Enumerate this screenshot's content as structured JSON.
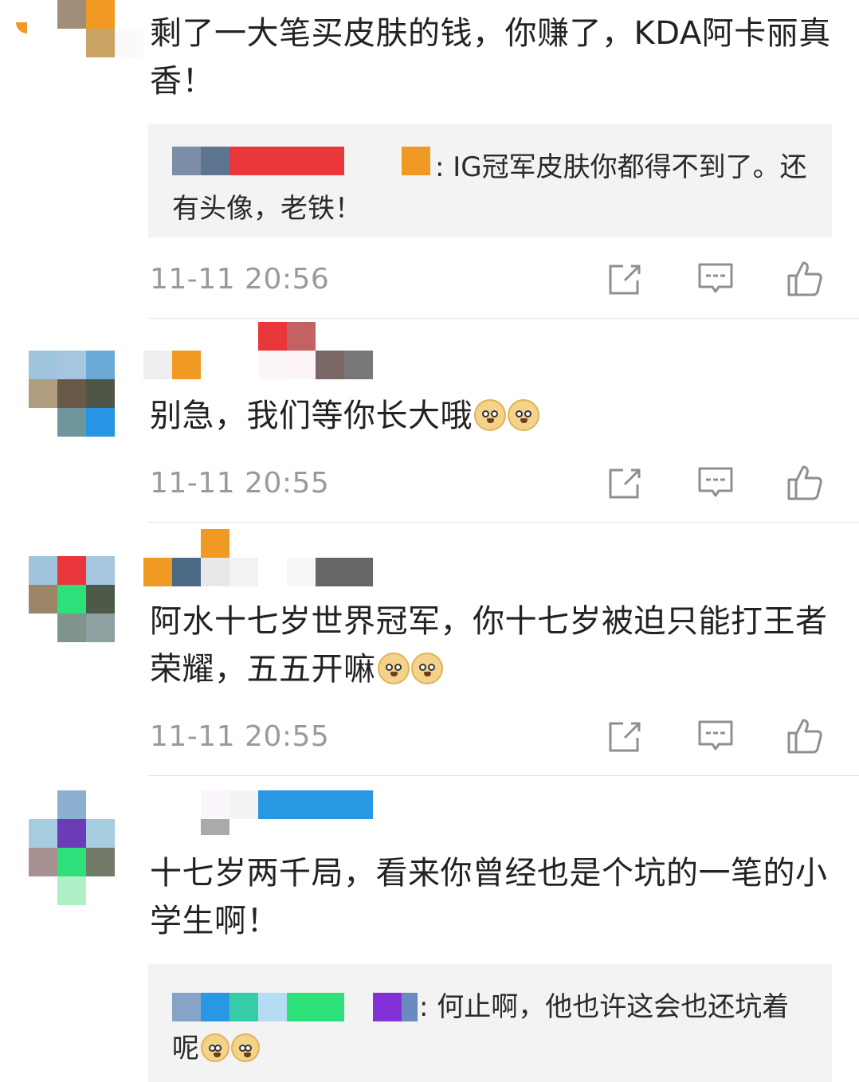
{
  "comments": [
    {
      "text": "剩了一大笔买皮肤的钱，你赚了，KDA阿卡丽真香！",
      "reply": {
        "text": "IG冠军皮肤你都得不到了。还有头像，老铁！",
        "prefix": ": "
      },
      "time": "11-11 20:56"
    },
    {
      "text": "别急，我们等你长大哦",
      "emoji_count": 2,
      "time": "11-11 20:55"
    },
    {
      "text": "阿水十七岁世界冠军，你十七岁被迫只能打王者荣耀，五五开嘛",
      "emoji_count": 2,
      "time": "11-11 20:55"
    },
    {
      "text": "十七岁两千局，看来你曾经也是个坑的一笔的小学生啊！",
      "reply": {
        "text": "何止啊，他也许这会也还坑着呢",
        "prefix": ": ",
        "emoji_count": 2
      }
    }
  ],
  "actions": {
    "repost_icon": "share-box-icon",
    "comment_icon": "comment-bubble-icon",
    "like_icon": "thumbs-up-icon"
  },
  "colors": {
    "time": "#9a9a9a",
    "reply_bg": "#f3f3f3",
    "divider": "#e4e4e4",
    "icon": "#8f8f8f"
  }
}
